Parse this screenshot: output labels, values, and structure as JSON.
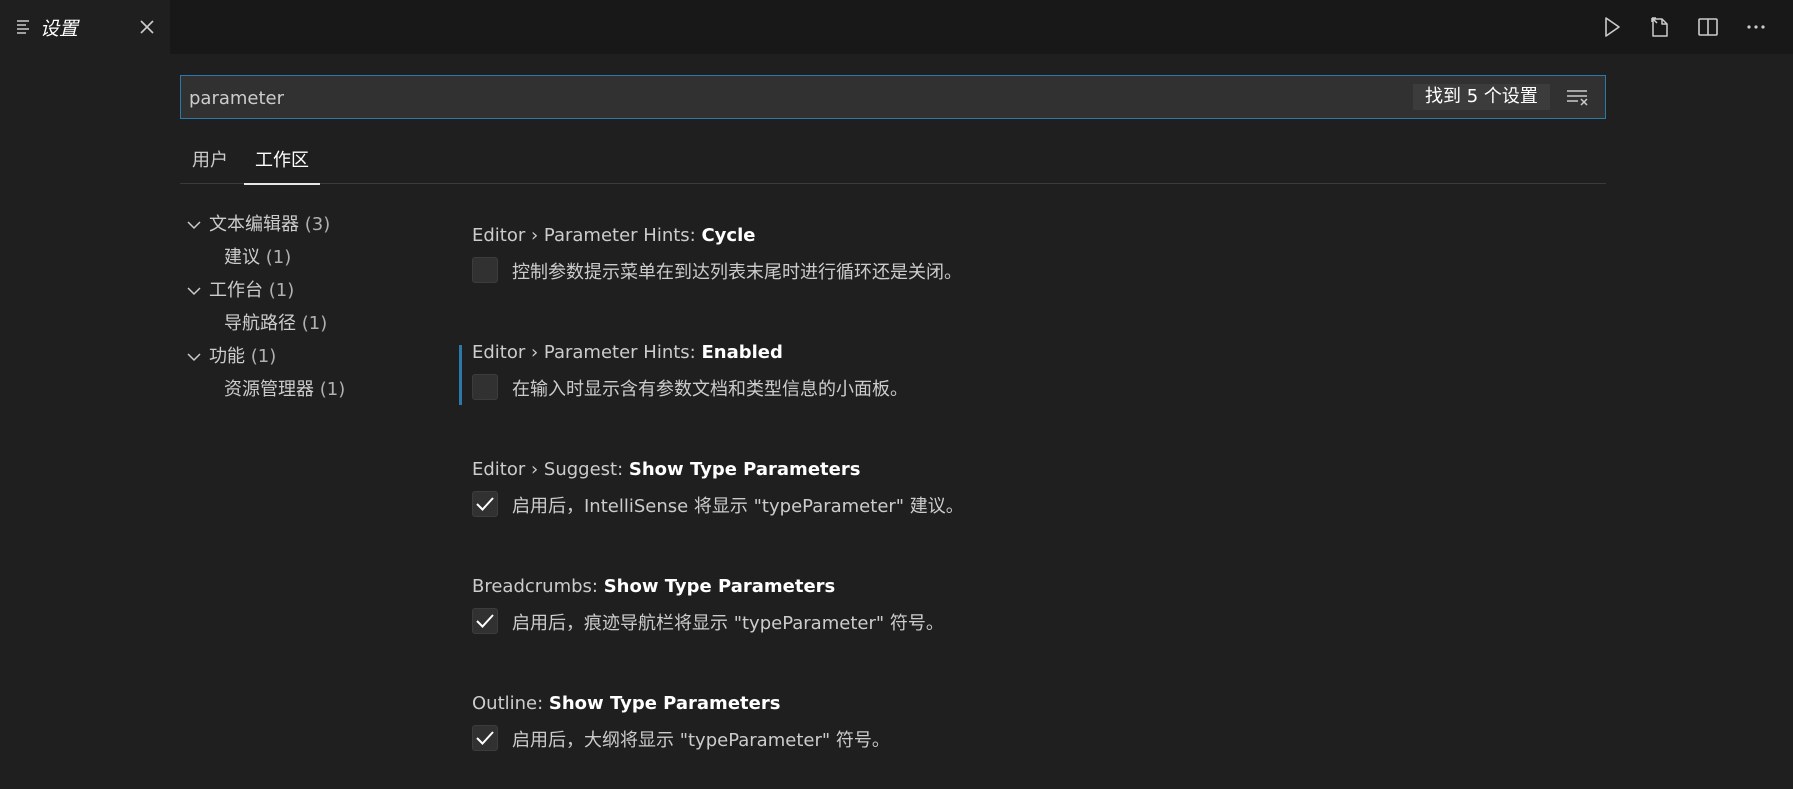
{
  "tab": {
    "title": "设置",
    "icon": "settings-list-icon"
  },
  "actions": [
    "run-icon",
    "open-settings-json-icon",
    "split-editor-icon",
    "more-actions-icon"
  ],
  "search": {
    "value": "parameter",
    "result_count": "找到 5 个设置"
  },
  "scope_tabs": [
    {
      "label": "用户",
      "active": false
    },
    {
      "label": "工作区",
      "active": true
    }
  ],
  "toc": [
    {
      "label": "文本编辑器",
      "count": "(3)",
      "expandable": true
    },
    {
      "label": "建议",
      "count": "(1)",
      "expandable": false
    },
    {
      "label": "工作台",
      "count": "(1)",
      "expandable": true
    },
    {
      "label": "导航路径",
      "count": "(1)",
      "expandable": false
    },
    {
      "label": "功能",
      "count": "(1)",
      "expandable": true
    },
    {
      "label": "资源管理器",
      "count": "(1)",
      "expandable": false
    }
  ],
  "settings": [
    {
      "category": "Editor › Parameter Hints: ",
      "name": "Cycle",
      "description": "控制参数提示菜单在到达列表末尾时进行循环还是关闭。",
      "checked": false
    },
    {
      "category": "Editor › Parameter Hints: ",
      "name": "Enabled",
      "description": "在输入时显示含有参数文档和类型信息的小面板。",
      "checked": false
    },
    {
      "category": "Editor › Suggest: ",
      "name": "Show Type Parameters",
      "description": "启用后，IntelliSense 将显示 \"typeParameter\" 建议。",
      "checked": true
    },
    {
      "category": "Breadcrumbs: ",
      "name": "Show Type Parameters",
      "description": "启用后，痕迹导航栏将显示 \"typeParameter\" 符号。",
      "checked": true
    },
    {
      "category": "Outline: ",
      "name": "Show Type Parameters",
      "description": "启用后，大纲将显示 \"typeParameter\" 符号。",
      "checked": true
    }
  ],
  "colors": {
    "accent": "#2b79a8",
    "background": "#1f1f1f",
    "tabbar": "#181818"
  }
}
